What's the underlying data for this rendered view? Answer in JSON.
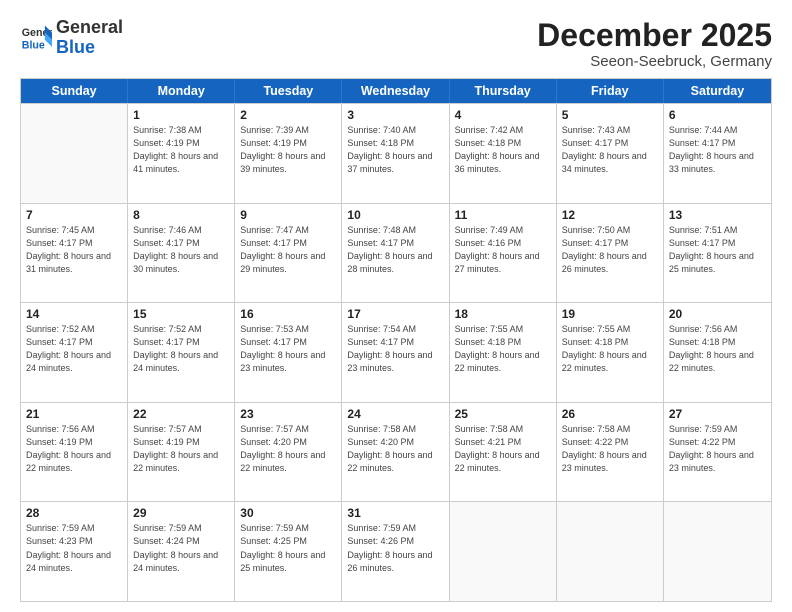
{
  "header": {
    "logo_general": "General",
    "logo_blue": "Blue",
    "title": "December 2025",
    "subtitle": "Seeon-Seebruck, Germany"
  },
  "days_of_week": [
    "Sunday",
    "Monday",
    "Tuesday",
    "Wednesday",
    "Thursday",
    "Friday",
    "Saturday"
  ],
  "weeks": [
    [
      {
        "day": null,
        "sunrise": null,
        "sunset": null,
        "daylight": null
      },
      {
        "day": "1",
        "sunrise": "7:38 AM",
        "sunset": "4:19 PM",
        "daylight": "8 hours and 41 minutes."
      },
      {
        "day": "2",
        "sunrise": "7:39 AM",
        "sunset": "4:19 PM",
        "daylight": "8 hours and 39 minutes."
      },
      {
        "day": "3",
        "sunrise": "7:40 AM",
        "sunset": "4:18 PM",
        "daylight": "8 hours and 37 minutes."
      },
      {
        "day": "4",
        "sunrise": "7:42 AM",
        "sunset": "4:18 PM",
        "daylight": "8 hours and 36 minutes."
      },
      {
        "day": "5",
        "sunrise": "7:43 AM",
        "sunset": "4:17 PM",
        "daylight": "8 hours and 34 minutes."
      },
      {
        "day": "6",
        "sunrise": "7:44 AM",
        "sunset": "4:17 PM",
        "daylight": "8 hours and 33 minutes."
      }
    ],
    [
      {
        "day": "7",
        "sunrise": "7:45 AM",
        "sunset": "4:17 PM",
        "daylight": "8 hours and 31 minutes."
      },
      {
        "day": "8",
        "sunrise": "7:46 AM",
        "sunset": "4:17 PM",
        "daylight": "8 hours and 30 minutes."
      },
      {
        "day": "9",
        "sunrise": "7:47 AM",
        "sunset": "4:17 PM",
        "daylight": "8 hours and 29 minutes."
      },
      {
        "day": "10",
        "sunrise": "7:48 AM",
        "sunset": "4:17 PM",
        "daylight": "8 hours and 28 minutes."
      },
      {
        "day": "11",
        "sunrise": "7:49 AM",
        "sunset": "4:16 PM",
        "daylight": "8 hours and 27 minutes."
      },
      {
        "day": "12",
        "sunrise": "7:50 AM",
        "sunset": "4:17 PM",
        "daylight": "8 hours and 26 minutes."
      },
      {
        "day": "13",
        "sunrise": "7:51 AM",
        "sunset": "4:17 PM",
        "daylight": "8 hours and 25 minutes."
      }
    ],
    [
      {
        "day": "14",
        "sunrise": "7:52 AM",
        "sunset": "4:17 PM",
        "daylight": "8 hours and 24 minutes."
      },
      {
        "day": "15",
        "sunrise": "7:52 AM",
        "sunset": "4:17 PM",
        "daylight": "8 hours and 24 minutes."
      },
      {
        "day": "16",
        "sunrise": "7:53 AM",
        "sunset": "4:17 PM",
        "daylight": "8 hours and 23 minutes."
      },
      {
        "day": "17",
        "sunrise": "7:54 AM",
        "sunset": "4:17 PM",
        "daylight": "8 hours and 23 minutes."
      },
      {
        "day": "18",
        "sunrise": "7:55 AM",
        "sunset": "4:18 PM",
        "daylight": "8 hours and 22 minutes."
      },
      {
        "day": "19",
        "sunrise": "7:55 AM",
        "sunset": "4:18 PM",
        "daylight": "8 hours and 22 minutes."
      },
      {
        "day": "20",
        "sunrise": "7:56 AM",
        "sunset": "4:18 PM",
        "daylight": "8 hours and 22 minutes."
      }
    ],
    [
      {
        "day": "21",
        "sunrise": "7:56 AM",
        "sunset": "4:19 PM",
        "daylight": "8 hours and 22 minutes."
      },
      {
        "day": "22",
        "sunrise": "7:57 AM",
        "sunset": "4:19 PM",
        "daylight": "8 hours and 22 minutes."
      },
      {
        "day": "23",
        "sunrise": "7:57 AM",
        "sunset": "4:20 PM",
        "daylight": "8 hours and 22 minutes."
      },
      {
        "day": "24",
        "sunrise": "7:58 AM",
        "sunset": "4:20 PM",
        "daylight": "8 hours and 22 minutes."
      },
      {
        "day": "25",
        "sunrise": "7:58 AM",
        "sunset": "4:21 PM",
        "daylight": "8 hours and 22 minutes."
      },
      {
        "day": "26",
        "sunrise": "7:58 AM",
        "sunset": "4:22 PM",
        "daylight": "8 hours and 23 minutes."
      },
      {
        "day": "27",
        "sunrise": "7:59 AM",
        "sunset": "4:22 PM",
        "daylight": "8 hours and 23 minutes."
      }
    ],
    [
      {
        "day": "28",
        "sunrise": "7:59 AM",
        "sunset": "4:23 PM",
        "daylight": "8 hours and 24 minutes."
      },
      {
        "day": "29",
        "sunrise": "7:59 AM",
        "sunset": "4:24 PM",
        "daylight": "8 hours and 24 minutes."
      },
      {
        "day": "30",
        "sunrise": "7:59 AM",
        "sunset": "4:25 PM",
        "daylight": "8 hours and 25 minutes."
      },
      {
        "day": "31",
        "sunrise": "7:59 AM",
        "sunset": "4:26 PM",
        "daylight": "8 hours and 26 minutes."
      },
      {
        "day": null,
        "sunrise": null,
        "sunset": null,
        "daylight": null
      },
      {
        "day": null,
        "sunrise": null,
        "sunset": null,
        "daylight": null
      },
      {
        "day": null,
        "sunrise": null,
        "sunset": null,
        "daylight": null
      }
    ]
  ]
}
